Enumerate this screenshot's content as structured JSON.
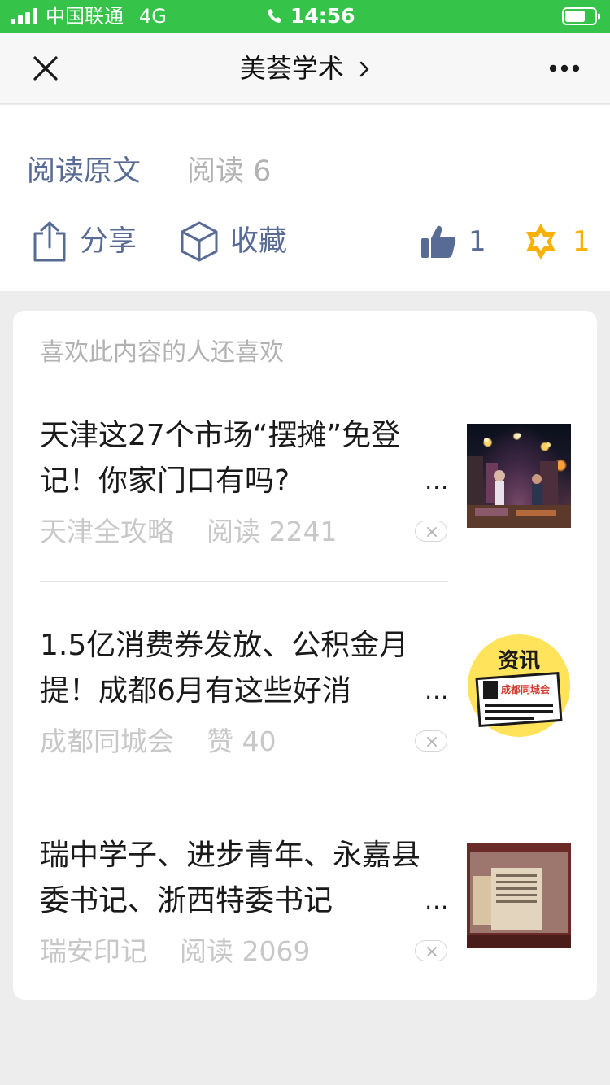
{
  "status_bar": {
    "carrier": "中国联通",
    "network": "4G",
    "time": "14:56"
  },
  "nav": {
    "title": "美荟学术"
  },
  "article_footer": {
    "read_original": "阅读原文",
    "read_count": "阅读 6",
    "share_label": "分享",
    "collect_label": "收藏",
    "like_count": "1",
    "wow_count": "1"
  },
  "recommendations": {
    "title": "喜欢此内容的人还喜欢",
    "items": [
      {
        "title": "天津这27个市场“摆摊”免登记！你家门口有吗?",
        "source": "天津全攻略",
        "stat": "阅读 2241"
      },
      {
        "title": "1.5亿消费券发放、公积金月提！成都6月有这些好消",
        "source": "成都同城会",
        "stat": "赞 40"
      },
      {
        "title": "瑞中学子、进步青年、永嘉县委书记、浙西特委书记",
        "source": "瑞安印记",
        "stat": "阅读 2069"
      }
    ],
    "thumb2_header": "资讯",
    "thumb2_label": "成都同城会"
  },
  "ellipsis": "...",
  "colors": {
    "status_bar": "#35c449",
    "link_blue": "#576b95",
    "wow_yellow": "#fab005",
    "muted_gray": "#b2b2b2"
  },
  "icons": [
    "signal-icon",
    "phone-icon",
    "battery-icon",
    "close-icon",
    "chevron-right-icon",
    "more-icon",
    "share-icon",
    "collect-icon",
    "thumbs-up-icon",
    "wow-icon",
    "dismiss-icon"
  ]
}
